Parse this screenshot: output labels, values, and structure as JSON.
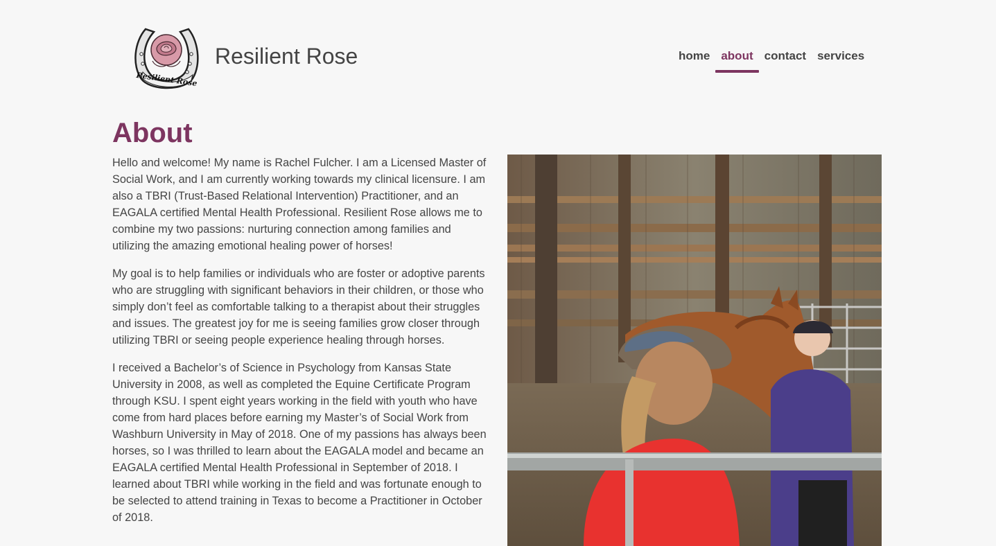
{
  "site": {
    "title": "Resilient Rose",
    "logo_text": "Resilient Rose",
    "brand_color": "#7d3560"
  },
  "nav": {
    "items": [
      {
        "label": "home",
        "active": false
      },
      {
        "label": "about",
        "active": true
      },
      {
        "label": "contact",
        "active": false
      },
      {
        "label": "services",
        "active": false
      }
    ]
  },
  "page": {
    "heading": "About",
    "paragraphs": [
      "Hello and welcome! My name is Rachel Fulcher. I am a Licensed Master of Social Work, and I am currently working towards my clinical licensure. I am also a TBRI (Trust-Based Relational Intervention) Practitioner, and an EAGALA certified Mental Health Professional. Resilient Rose allows me to combine my two passions: nurturing connection among families and utilizing the amazing emotional healing power of horses!",
      "My goal is to help families or individuals who are foster or adoptive parents who are struggling with significant behaviors in their children, or those who simply don’t feel as comfortable talking to a therapist about their struggles and issues. The greatest joy for me is seeing families grow closer through utilizing TBRI or seeing people experience healing through horses.",
      "I received a Bachelor’s of Science in Psychology from Kansas State University in 2008, as well as completed the Equine Certificate Program through KSU. I spent eight years working in the field with youth who have come from hard places before earning my Master’s of Social Work from Washburn University in May of 2018. One of my passions has always been horses, so I was thrilled to learn about the EAGALA model and became an EAGALA certified Mental Health Professional in September of 2018. I learned about TBRI while working in the field and was fortunate enough to be selected to attend training in Texas to become a Practitioner in October of 2018."
    ],
    "photo_alt": "Two women with a chestnut horse inside a wooden barn"
  }
}
